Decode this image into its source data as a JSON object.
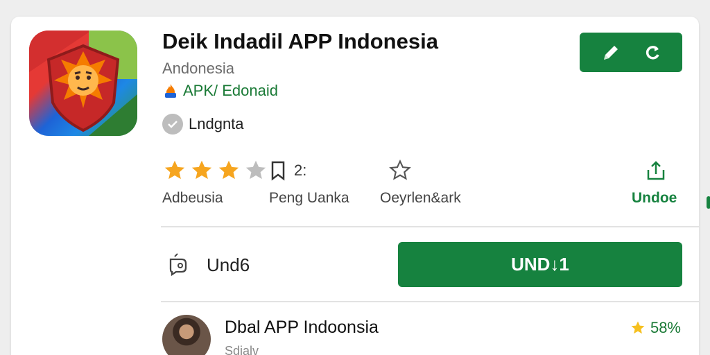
{
  "app": {
    "title": "Deik Indadil APP Indonesia",
    "developer": "Andonesia",
    "tag": "APK/ Edonaid",
    "verified_label": "Lndgnta"
  },
  "top_actions": {
    "edit_icon": "pencil-icon",
    "refresh_icon": "refresh-icon"
  },
  "stats": {
    "rating_stars": 3,
    "rating_max": 4,
    "rating_label": "Adbeusia",
    "bookmark_count": "2:",
    "bookmark_label": "Peng Uanka",
    "favorite_label": "Oeyrlen&ark",
    "share_label": "Undoe"
  },
  "secondary": {
    "label": "Und6"
  },
  "install": {
    "label": "UND↓1"
  },
  "review": {
    "name": "Dbal APP Indoonsia",
    "subtitle": "Sdialv",
    "score": "58%"
  },
  "colors": {
    "accent": "#16823f",
    "star": "#f6a51f",
    "star_empty": "#bdbdbd"
  }
}
